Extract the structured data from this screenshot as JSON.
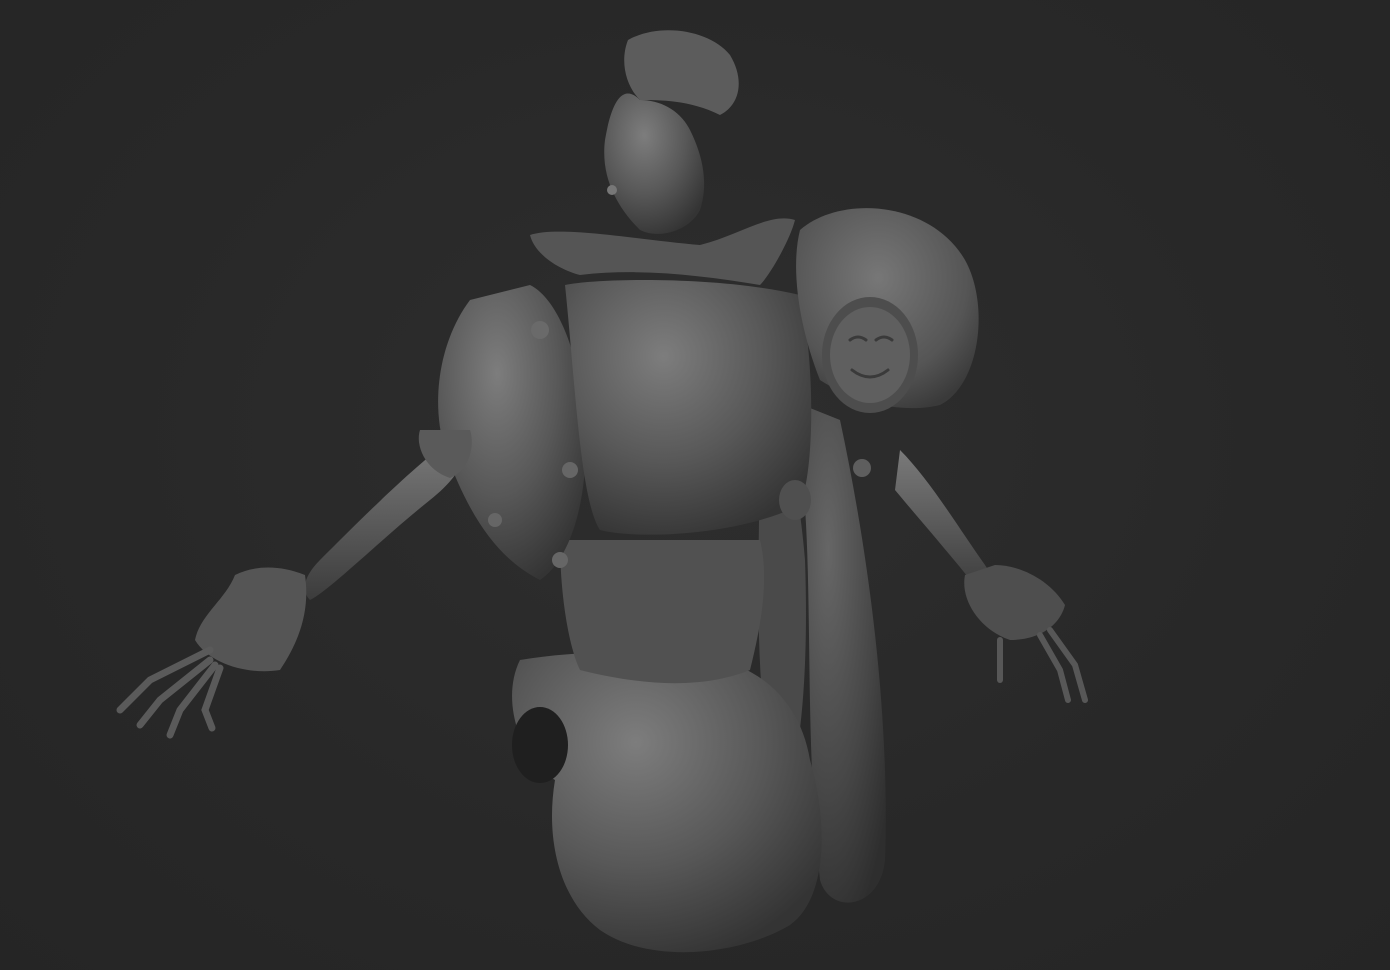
{
  "scene": {
    "background_color": "#292929",
    "material_base": "#5e5e5e",
    "material_highlight": "#8c8c8c",
    "material_shadow": "#2f2f2f",
    "subject": "grayscale-3d-sculpt-figure"
  }
}
